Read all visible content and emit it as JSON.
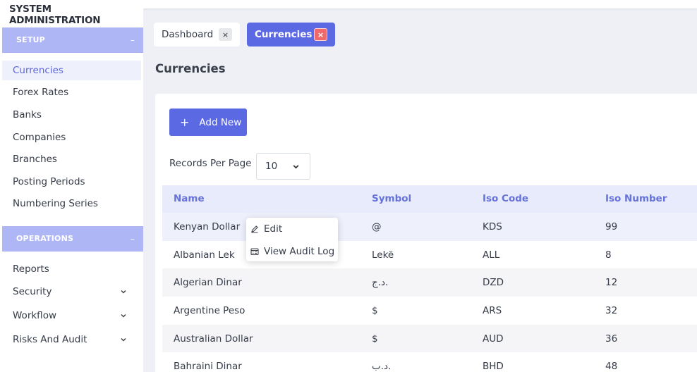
{
  "sidebar": {
    "app_title": "SYSTEM ADMINISTRATION",
    "setup": {
      "header": "SETUP",
      "toggle": "–",
      "items": [
        {
          "label": "Currencies"
        },
        {
          "label": "Forex Rates"
        },
        {
          "label": "Banks"
        },
        {
          "label": "Companies"
        },
        {
          "label": "Branches"
        },
        {
          "label": "Posting Periods"
        },
        {
          "label": "Numbering Series"
        }
      ]
    },
    "operations": {
      "header": "OPERATIONS",
      "toggle": "–",
      "items": [
        {
          "label": "Reports"
        },
        {
          "label": "Security"
        },
        {
          "label": "Workflow"
        },
        {
          "label": "Risks And Audit"
        }
      ]
    }
  },
  "tabs": [
    {
      "label": "Dashboard",
      "close": "×"
    },
    {
      "label": "Currencies",
      "close": "×"
    }
  ],
  "page": {
    "title": "Currencies",
    "add_button": "Add New",
    "add_icon": "+",
    "records_per_page_label": "Records Per Page",
    "records_per_page_value": "10"
  },
  "table": {
    "columns": [
      "Name",
      "Symbol",
      "Iso Code",
      "Iso Number"
    ],
    "rows": [
      {
        "name": "Kenyan Dollar",
        "symbol": "@",
        "iso_code": "KDS",
        "iso_number": "99"
      },
      {
        "name": "Albanian Lek",
        "symbol": "Lekë",
        "iso_code": "ALL",
        "iso_number": "8"
      },
      {
        "name": "Algerian Dinar",
        "symbol": "د.ج.",
        "iso_code": "DZD",
        "iso_number": "12"
      },
      {
        "name": "Argentine Peso",
        "symbol": "$",
        "iso_code": "ARS",
        "iso_number": "32"
      },
      {
        "name": "Australian Dollar",
        "symbol": "$",
        "iso_code": "AUD",
        "iso_number": "36"
      },
      {
        "name": "Bahraini Dinar",
        "symbol": "د.ب.",
        "iso_code": "BHD",
        "iso_number": "48"
      }
    ]
  },
  "context_menu": {
    "items": [
      {
        "label": "Edit",
        "icon": "pencil-icon"
      },
      {
        "label": "View Audit Log",
        "icon": "audit-log-icon"
      }
    ]
  },
  "colors": {
    "accent": "#5b69e3",
    "section_header": "#aeb6f6",
    "close_danger": "#f06a6a",
    "table_header_text": "#6572d8"
  }
}
